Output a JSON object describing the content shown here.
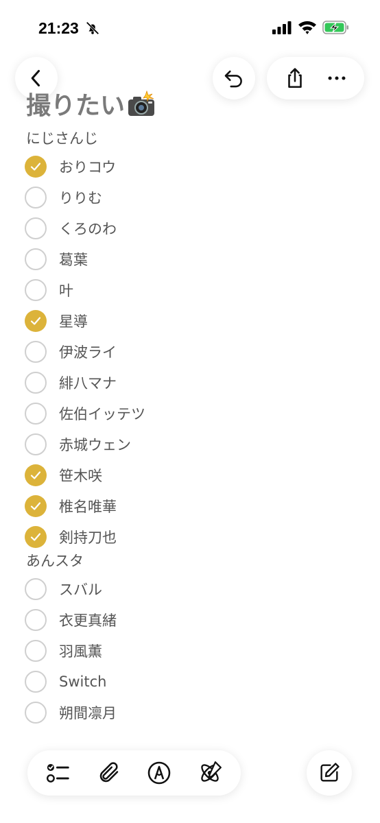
{
  "status_bar": {
    "time": "21:23"
  },
  "note": {
    "title": "撮りたい"
  },
  "sections": [
    {
      "heading": "にじさんじ",
      "items": [
        {
          "label": "おりコウ",
          "checked": true
        },
        {
          "label": "りりむ",
          "checked": false
        },
        {
          "label": "くろのわ",
          "checked": false
        },
        {
          "label": "葛葉",
          "checked": false
        },
        {
          "label": "叶",
          "checked": false
        },
        {
          "label": "星導",
          "checked": true
        },
        {
          "label": "伊波ライ",
          "checked": false
        },
        {
          "label": "緋八マナ",
          "checked": false
        },
        {
          "label": "佐伯イッテツ",
          "checked": false
        },
        {
          "label": "赤城ウェン",
          "checked": false
        },
        {
          "label": "笹木咲",
          "checked": true
        },
        {
          "label": "椎名唯華",
          "checked": true
        },
        {
          "label": "剣持刀也",
          "checked": true
        }
      ]
    },
    {
      "heading": "あんスタ",
      "items": [
        {
          "label": "スバル",
          "checked": false
        },
        {
          "label": "衣更真緒",
          "checked": false
        },
        {
          "label": "羽風薫",
          "checked": false
        },
        {
          "label": "Switch",
          "checked": false
        },
        {
          "label": "朔間凛月",
          "checked": false
        }
      ]
    }
  ],
  "icons": {
    "back": "chevron-left-icon",
    "undo": "undo-icon",
    "share": "share-icon",
    "more": "more-icon",
    "checklist": "checklist-icon",
    "attachment": "paperclip-icon",
    "markup": "pen-icon",
    "ai": "writing-tools-icon",
    "compose": "compose-icon",
    "title_emoji": "camera-flash-icon"
  },
  "colors": {
    "accent": "#dcb33a",
    "text": "#555555"
  }
}
